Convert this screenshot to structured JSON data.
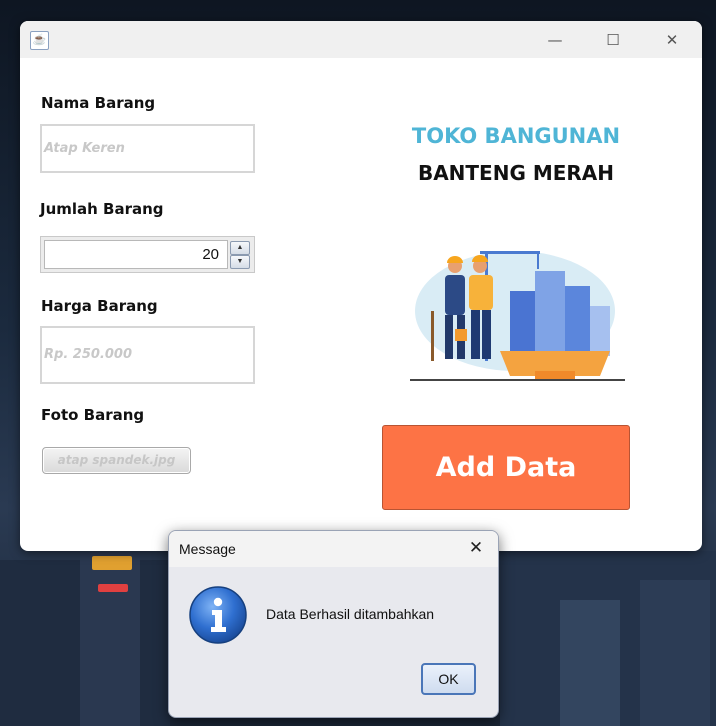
{
  "window": {
    "title": "",
    "controls": {
      "minimize": "—",
      "maximize": "☐",
      "close": "✕"
    }
  },
  "form": {
    "nama_label": "Nama Barang",
    "nama_placeholder": "Atap Keren",
    "jumlah_label": "Jumlah Barang",
    "jumlah_value": "20",
    "harga_label": "Harga Barang",
    "harga_placeholder": "Rp. 250.000",
    "foto_label": "Foto Barang",
    "foto_file": "atap spandek.jpg"
  },
  "brand": {
    "line1": "TOKO BANGUNAN",
    "line2": "BANTENG MERAH"
  },
  "add_button_label": "Add Data",
  "dialog": {
    "title": "Message",
    "message": "Data Berhasil ditambahkan",
    "ok_label": "OK"
  },
  "icons": {
    "app": "java-icon",
    "info": "info-icon",
    "illustration": "construction-workers-illustration"
  },
  "colors": {
    "accent": "#fd7345",
    "brand_blue": "#4fb5d6",
    "window_bg": "#ffffff"
  }
}
